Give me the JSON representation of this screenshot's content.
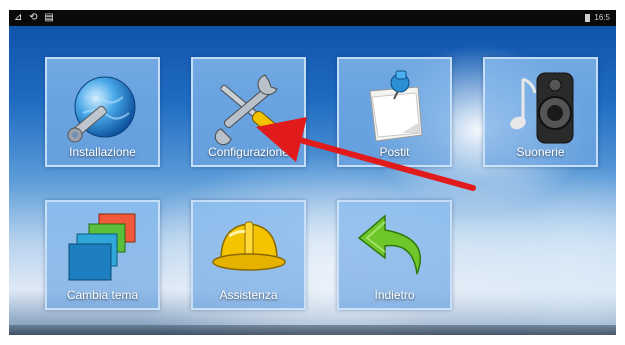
{
  "status_bar": {
    "left_icons": "⊿ ⟲ ▤",
    "time": "16:5"
  },
  "tiles": [
    {
      "label": "Installazione",
      "icon": "globe-wrench-icon"
    },
    {
      "label": "Configurazione",
      "icon": "tools-icon"
    },
    {
      "label": "Postit",
      "icon": "sticky-note-icon"
    },
    {
      "label": "Suonerie",
      "icon": "speaker-icon"
    },
    {
      "label": "Cambia tema",
      "icon": "windows-icon"
    },
    {
      "label": "Assistenza",
      "icon": "hardhat-icon"
    },
    {
      "label": "Indietro",
      "icon": "back-arrow-icon"
    }
  ],
  "annotation": {
    "color": "#e11b1b"
  }
}
